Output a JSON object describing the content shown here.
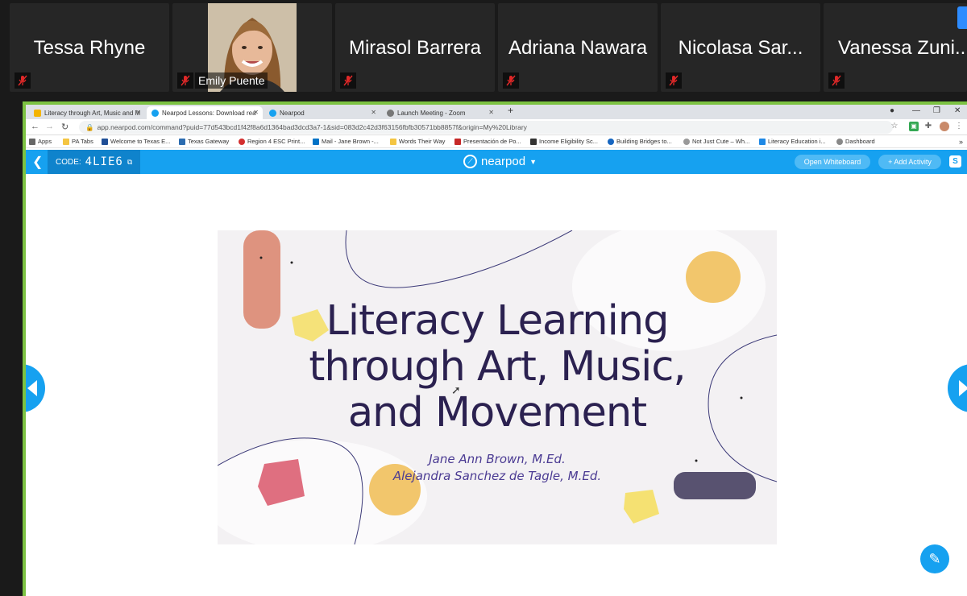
{
  "participants": [
    {
      "name": "Tessa Rhyne",
      "muted": true
    },
    {
      "name": "Emily Puente",
      "muted": true,
      "has_video": true
    },
    {
      "name": "Mirasol Barrera",
      "muted": true
    },
    {
      "name": "Adriana Nawara",
      "muted": true
    },
    {
      "name": "Nicolasa Sar...",
      "muted": true
    },
    {
      "name": "Vanessa Zuni...",
      "muted": true
    }
  ],
  "browser": {
    "tabs": [
      {
        "label": "Literacy through Art, Music and M",
        "active": false,
        "fav_color": "#f4b400"
      },
      {
        "label": "Nearpod Lessons: Download rea",
        "active": true,
        "fav_color": "#16a1f0"
      },
      {
        "label": "Nearpod",
        "active": false,
        "fav_color": "#16a1f0"
      },
      {
        "label": "Launch Meeting - Zoom",
        "active": false,
        "fav_color": "#777777"
      }
    ],
    "new_tab": "+",
    "url": "app.nearpod.com/command?puid=77d543bcd1f42f8a6d1364bad3dcd3a7-1&sid=083d2c42d3f63156fbfb30571bb8857f&origin=My%20Library",
    "bookmarks": [
      {
        "label": "Apps",
        "color": "#666666"
      },
      {
        "label": "PA Tabs",
        "color": "#f4c542"
      },
      {
        "label": "Welcome to Texas E...",
        "color": "#1f4e96"
      },
      {
        "label": "Texas Gateway",
        "color": "#2b6cb0"
      },
      {
        "label": "Region 4 ESC Print...",
        "color": "#d32f2f"
      },
      {
        "label": "Mail - Jane Brown -...",
        "color": "#0072c6"
      },
      {
        "label": "Words Their Way",
        "color": "#f4c542"
      },
      {
        "label": "Presentación de Po...",
        "color": "#c62828"
      },
      {
        "label": "Income Eligibility Sc...",
        "color": "#333333"
      },
      {
        "label": "Building Bridges to...",
        "color": "#1565c0"
      },
      {
        "label": "Not Just Cute – Wh...",
        "color": "#999999"
      },
      {
        "label": "Literacy Education i...",
        "color": "#1e88e5"
      },
      {
        "label": "Dashboard",
        "color": "#888888"
      }
    ]
  },
  "nearpod": {
    "code_label": "CODE:",
    "code_value": "4LIE6",
    "brand": "nearpod",
    "open_whiteboard": "Open Whiteboard",
    "add_activity": "+ Add Activity"
  },
  "slide": {
    "title_lines": [
      "Literacy Learning",
      "through Art, Music,",
      "and Movement"
    ],
    "author_1": "Jane Ann Brown, M.Ed.",
    "author_2": "Alejandra Sanchez de Tagle, M.Ed."
  },
  "colors": {
    "nearpod_blue": "#16a1f0",
    "share_border": "#7cc242",
    "title_color": "#2b2150",
    "author_color": "#4b3b93"
  }
}
